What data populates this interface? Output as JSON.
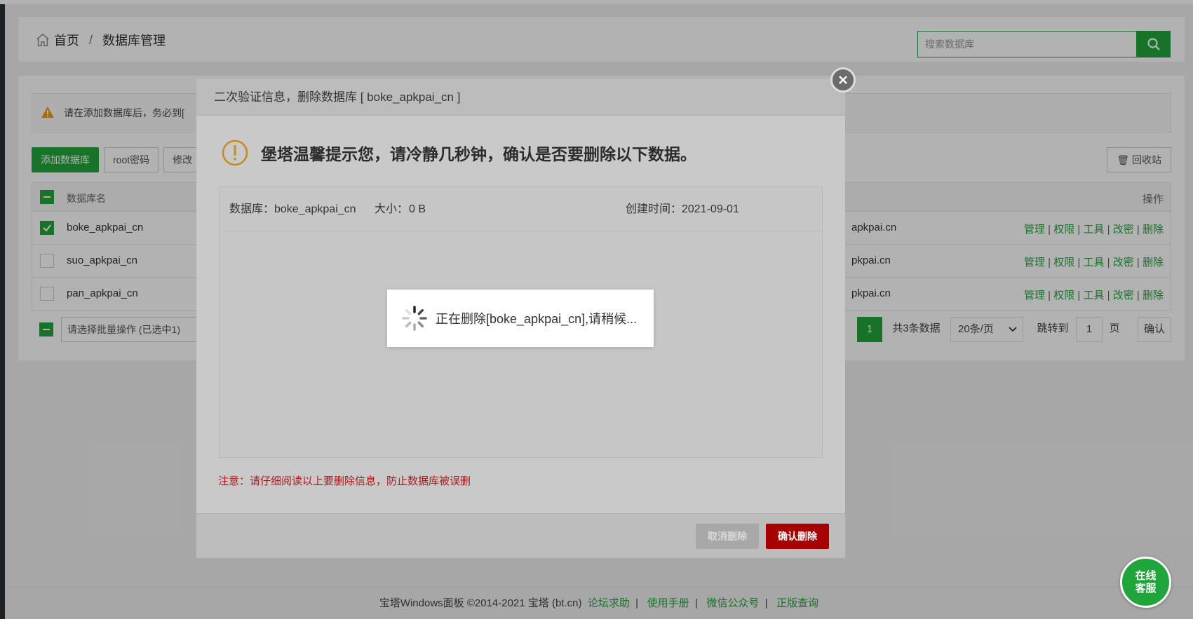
{
  "breadcrumb": {
    "home": "首页",
    "separator": "/",
    "current": "数据库管理"
  },
  "search": {
    "placeholder": "搜索数据库"
  },
  "alert": {
    "text": "请在添加数据库后，务必到["
  },
  "toolbar": {
    "add_label": "添加数据库",
    "root_label": "root密码",
    "modify_label": "修改",
    "recycle_label": "回收站"
  },
  "table": {
    "headers": {
      "name": "数据库名",
      "ops": "操作"
    },
    "rows": [
      {
        "name": "boke_apkpai_cn",
        "tail": "apkpai.cn",
        "checked": true
      },
      {
        "name": "suo_apkpai_cn",
        "tail": "pkpai.cn",
        "checked": false
      },
      {
        "name": "pan_apkpai_cn",
        "tail": "pkpai.cn",
        "checked": false
      }
    ],
    "ops": [
      "管理",
      "权限",
      "工具",
      "改密",
      "删除"
    ],
    "op_sep": "|"
  },
  "pager": {
    "batch_placeholder": "请选择批量操作 (已选中1)",
    "current_page": "1",
    "total": "共3条数据",
    "per_page": "20条/页",
    "jump_label": "跳转到",
    "jump_value": "1",
    "page_unit": "页",
    "confirm": "确认"
  },
  "dialog": {
    "title": "二次验证信息，删除数据库 [ boke_apkpai_cn ]",
    "tip": "堡塔温馨提示您，请冷静几秒钟，确认是否要删除以下数据。",
    "db_label": "数据库：boke_apkpai_cn",
    "size_label": "大小：",
    "size_value": "0 B",
    "created_label": "创建时间：2021-09-01",
    "note": "注意：请仔细阅读以上要删除信息，防止数据库被误删",
    "cancel_label": "取消删除",
    "confirm_label": "确认删除"
  },
  "toast": {
    "text": "正在删除[boke_apkpai_cn],请稍候..."
  },
  "footer": {
    "copyright": "宝塔Windows面板 ©2014-2021 宝塔 (bt.cn)",
    "links": [
      "论坛求助",
      "使用手册",
      "微信公众号",
      "正版查询"
    ],
    "sep": "|"
  },
  "chat": {
    "line1": "在线",
    "line2": "客服"
  },
  "colors": {
    "brand_green": "#20a53a",
    "danger_red": "#a80000",
    "note_red": "#b0161a"
  }
}
